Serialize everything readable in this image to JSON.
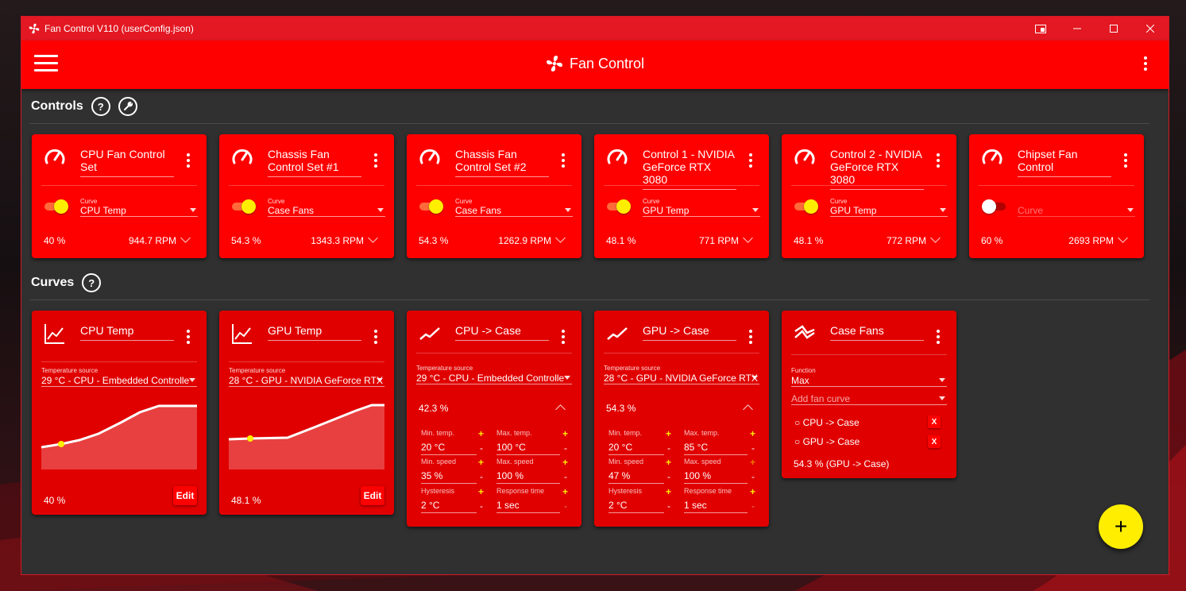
{
  "window": {
    "title": "Fan Control V110 (userConfig.json)"
  },
  "appbar": {
    "title": "Fan Control"
  },
  "sections": {
    "controls": "Controls",
    "curves": "Curves",
    "help_glyph": "?"
  },
  "controls": [
    {
      "name": "CPU Fan Control Set",
      "curve_label": "Curve",
      "curve": "CPU Temp",
      "percent": "40 %",
      "rpm": "944.7 RPM",
      "enabled": true
    },
    {
      "name": "Chassis Fan Control Set #1",
      "curve_label": "Curve",
      "curve": "Case Fans",
      "percent": "54.3 %",
      "rpm": "1343.3 RPM",
      "enabled": true
    },
    {
      "name": "Chassis Fan Control Set #2",
      "curve_label": "Curve",
      "curve": "Case Fans",
      "percent": "54.3 %",
      "rpm": "1262.9 RPM",
      "enabled": true
    },
    {
      "name": "Control 1 - NVIDIA GeForce RTX 3080",
      "curve_label": "Curve",
      "curve": "GPU Temp",
      "percent": "48.1 %",
      "rpm": "771 RPM",
      "enabled": true
    },
    {
      "name": "Control 2 - NVIDIA GeForce RTX 3080",
      "curve_label": "Curve",
      "curve": "GPU Temp",
      "percent": "48.1 %",
      "rpm": "772 RPM",
      "enabled": true
    },
    {
      "name": "Chipset Fan Control",
      "curve_label": "",
      "curve": "Curve",
      "percent": "60 %",
      "rpm": "2693 RPM",
      "enabled": false
    }
  ],
  "curves": {
    "cpu_temp": {
      "name": "CPU Temp",
      "source_label": "Temperature source",
      "source": "29 °C - CPU - Embedded Controlle",
      "percent": "40 %",
      "edit": "Edit"
    },
    "gpu_temp": {
      "name": "GPU Temp",
      "source_label": "Temperature source",
      "source": "28 °C - GPU - NVIDIA GeForce RTX",
      "percent": "48.1 %",
      "edit": "Edit"
    },
    "cpu_case": {
      "name": "CPU -> Case",
      "source_label": "Temperature source",
      "source": "29 °C - CPU - Embedded Controlle",
      "percent": "42.3 %",
      "min_temp_label": "Min. temp.",
      "min_temp": "20 °C",
      "max_temp_label": "Max. temp.",
      "max_temp": "100 °C",
      "min_speed_label": "Min. speed",
      "min_speed": "35 %",
      "max_speed_label": "Max. speed",
      "max_speed": "100 %",
      "hyst_label": "Hysteresis",
      "hyst": "2 °C",
      "resp_label": "Response time",
      "resp": "1 sec"
    },
    "gpu_case": {
      "name": "GPU -> Case",
      "source_label": "Temperature source",
      "source": "28 °C - GPU - NVIDIA GeForce RTX",
      "percent": "54.3 %",
      "min_temp_label": "Min. temp.",
      "min_temp": "20 °C",
      "max_temp_label": "Max. temp.",
      "max_temp": "85 °C",
      "min_speed_label": "Min. speed",
      "min_speed": "47 %",
      "max_speed_label": "Max. speed",
      "max_speed": "100 %",
      "hyst_label": "Hysteresis",
      "hyst": "2 °C",
      "resp_label": "Response time",
      "resp": "1 sec"
    },
    "case_fans": {
      "name": "Case Fans",
      "function_label": "Function",
      "function": "Max",
      "add_placeholder": "Add fan curve",
      "items": [
        "CPU -> Case",
        "GPU -> Case"
      ],
      "remove_label": "X",
      "result": "54.3 % (GPU -> Case)"
    }
  },
  "fab": {
    "label": "+"
  },
  "colors": {
    "accent": "#ff0000",
    "titlebar": "#e31822",
    "background": "#303030",
    "highlight": "#ffee00"
  }
}
